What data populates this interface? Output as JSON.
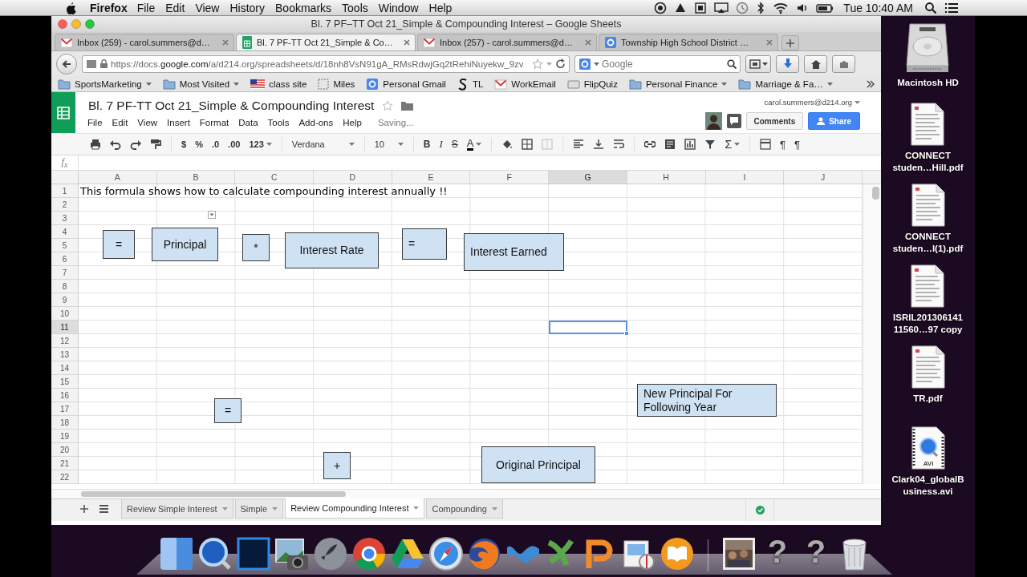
{
  "menubar": {
    "app": "Firefox",
    "menus": [
      "File",
      "Edit",
      "View",
      "History",
      "Bookmarks",
      "Tools",
      "Window",
      "Help"
    ],
    "clock": "Tue 10:40 AM"
  },
  "window": {
    "title": "Bl. 7 PF–TT Oct 21_Simple & Compounding Interest – Google Sheets"
  },
  "browser_tabs": [
    {
      "label": "Inbox (259) - carol.summers@d…",
      "kind": "mail",
      "selected": false
    },
    {
      "label": "Bl. 7 PF-TT Oct 21_Simple & Co…",
      "kind": "sheets",
      "selected": true
    },
    {
      "label": "Inbox (257) - carol.summers@d…",
      "kind": "mail",
      "selected": false
    },
    {
      "label": "Township High School District …",
      "kind": "google",
      "selected": false
    }
  ],
  "address_bar": {
    "url": "https://docs.**google.com**/a/d214.org/spreadsheets/d/18nh8VsN91gA_RMsRdwjGq2tRehiNuyekw_9zv"
  },
  "search_field": {
    "placeholder": "Google"
  },
  "bookmarks": [
    {
      "label": "SportsMarketing",
      "kind": "folder",
      "has_menu": true
    },
    {
      "label": "Most Visited",
      "kind": "folder",
      "has_menu": true
    },
    {
      "label": "class site",
      "kind": "flag",
      "has_menu": false
    },
    {
      "label": "Miles",
      "kind": "page",
      "has_menu": false
    },
    {
      "label": "Personal Gmail",
      "kind": "google",
      "has_menu": false
    },
    {
      "label": "TL",
      "kind": "curve",
      "has_menu": false
    },
    {
      "label": "WorkEmail",
      "kind": "mail",
      "has_menu": false
    },
    {
      "label": "FlipQuiz",
      "kind": "card",
      "has_menu": false
    },
    {
      "label": "Personal Finance",
      "kind": "folder",
      "has_menu": true
    },
    {
      "label": "Marriage & Fa…",
      "kind": "folder",
      "has_menu": true
    }
  ],
  "doc": {
    "title": "Bl. 7 PF-TT Oct 21_Simple & Compounding Interest",
    "account": "carol.summers@d214.org",
    "menus": [
      "File",
      "Edit",
      "View",
      "Insert",
      "Format",
      "Data",
      "Tools",
      "Add-ons",
      "Help"
    ],
    "status": "Saving...",
    "comments_button": "Comments",
    "share_button": "Share"
  },
  "toolbar": {
    "currency": "$",
    "percent": "%",
    "decimal_less": ".0",
    "decimal_more": ".00",
    "number_format": "123",
    "font": "Verdana",
    "font_size": "10",
    "bold": "B",
    "italic": "I",
    "strikethrough": "S",
    "text_color": "A",
    "functions": "Σ",
    "ltr": "¶",
    "rtl": "¶"
  },
  "formula_bar": {
    "label": "f$_{x}$"
  },
  "sheet": {
    "columns": [
      {
        "label": "A",
        "selected": false
      },
      {
        "label": "B",
        "selected": false
      },
      {
        "label": "C",
        "selected": false
      },
      {
        "label": "D",
        "selected": false
      },
      {
        "label": "E",
        "selected": false
      },
      {
        "label": "F",
        "selected": false
      },
      {
        "label": "G",
        "selected": true
      },
      {
        "label": "H",
        "selected": false
      },
      {
        "label": "I",
        "selected": false
      },
      {
        "label": "J",
        "selected": false
      }
    ],
    "rows": [
      {
        "header": "1",
        "selected": false,
        "cells": [
          "This formula shows how to calculate compounding interest annually !!"
        ]
      },
      {
        "header": "2",
        "selected": false
      },
      {
        "header": "3",
        "selected": false
      },
      {
        "header": "4",
        "selected": false
      },
      {
        "header": "5",
        "selected": false
      },
      {
        "header": "6",
        "selected": false
      },
      {
        "header": "7",
        "selected": false
      },
      {
        "header": "8",
        "selected": false
      },
      {
        "header": "9",
        "selected": false
      },
      {
        "header": "10",
        "selected": false
      },
      {
        "header": "11",
        "selected": true
      },
      {
        "header": "12",
        "selected": false
      },
      {
        "header": "13",
        "selected": false
      },
      {
        "header": "14",
        "selected": false
      },
      {
        "header": "15",
        "selected": false
      },
      {
        "header": "16",
        "selected": false
      },
      {
        "header": "17",
        "selected": false
      },
      {
        "header": "18",
        "selected": false
      },
      {
        "header": "19",
        "selected": false
      },
      {
        "header": "20",
        "selected": false
      },
      {
        "header": "21",
        "selected": false
      },
      {
        "header": "22",
        "selected": false
      }
    ],
    "shapes": [
      {
        "text": "="
      },
      {
        "text": "Principal"
      },
      {
        "text": "*"
      },
      {
        "text": "Interest Rate"
      },
      {
        "text": "="
      },
      {
        "text": "Interest Earned"
      },
      {
        "text": "="
      },
      {
        "text": "New Principal For Following Year"
      },
      {
        "text": "+"
      },
      {
        "text": "Original Principal"
      }
    ]
  },
  "sheet_tabs": [
    {
      "label": "Review Simple Interest",
      "selected": false
    },
    {
      "label": "Simple",
      "selected": false
    },
    {
      "label": "Review Compounding Interest",
      "selected": true
    },
    {
      "label": "Compounding",
      "selected": false
    }
  ],
  "desktop_icons": [
    {
      "kind": "drive",
      "lines": [
        "Macintosh HD"
      ]
    },
    {
      "kind": "document",
      "lines": [
        "CONNECT",
        "studen…Hill.pdf"
      ]
    },
    {
      "kind": "document",
      "lines": [
        "CONNECT",
        "studen…l(1).pdf"
      ]
    },
    {
      "kind": "document",
      "lines": [
        "ISRIL201306141",
        "11560…97 copy"
      ]
    },
    {
      "kind": "document",
      "lines": [
        "TR.pdf"
      ]
    },
    {
      "kind": "video",
      "badge": "AVI",
      "lines": [
        "Clark04_globalB",
        "usiness.avi"
      ]
    }
  ],
  "dock": {
    "missing_apps": [
      "?",
      "?"
    ]
  }
}
